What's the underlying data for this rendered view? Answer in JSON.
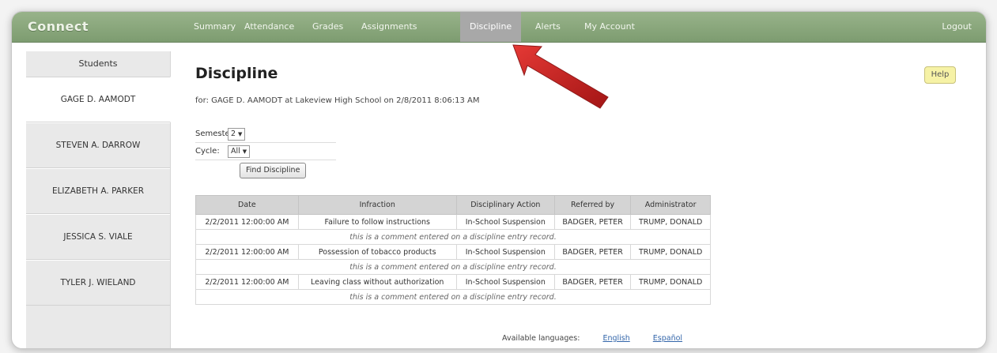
{
  "brand": "Connect",
  "nav": {
    "items": [
      "Summary",
      "Attendance",
      "Grades",
      "Assignments",
      "Discipline",
      "Alerts",
      "My Account"
    ],
    "active": "Discipline",
    "logout": "Logout"
  },
  "sidebar": {
    "title": "Students",
    "students": [
      "GAGE D. AAMODT",
      "STEVEN A. DARROW",
      "ELIZABETH A. PARKER",
      "JESSICA S. VIALE",
      "TYLER J. WIELAND"
    ],
    "selected": "GAGE D. AAMODT"
  },
  "page": {
    "title": "Discipline",
    "subtitle": "for: GAGE D. AAMODT at Lakeview High School on 2/8/2011 8:06:13 AM",
    "help": "Help"
  },
  "filters": {
    "semester_label": "Semester:",
    "semester_value": "2",
    "cycle_label": "Cycle:",
    "cycle_value": "All",
    "find_button": "Find Discipline"
  },
  "table": {
    "headers": [
      "Date",
      "Infraction",
      "Disciplinary Action",
      "Referred by",
      "Administrator"
    ],
    "rows": [
      {
        "date": "2/2/2011 12:00:00 AM",
        "infraction": "Failure to follow instructions",
        "action": "In-School Suspension",
        "referred_by": "BADGER, PETER",
        "administrator": "TRUMP, DONALD",
        "comment": "this is a comment entered on a discipline entry record."
      },
      {
        "date": "2/2/2011 12:00:00 AM",
        "infraction": "Possession of tobacco products",
        "action": "In-School Suspension",
        "referred_by": "BADGER, PETER",
        "administrator": "TRUMP, DONALD",
        "comment": "this is a comment entered on a discipline entry record."
      },
      {
        "date": "2/2/2011 12:00:00 AM",
        "infraction": "Leaving class without authorization",
        "action": "In-School Suspension",
        "referred_by": "BADGER, PETER",
        "administrator": "TRUMP, DONALD",
        "comment": "this is a comment entered on a discipline entry record."
      }
    ]
  },
  "languages": {
    "label": "Available languages:",
    "options": [
      "English",
      "Español"
    ]
  },
  "colors": {
    "nav_green": "#8aa87c",
    "active_tab": "#a8a8a8",
    "help_yellow": "#f6f2a6",
    "arrow_red": "#c62828"
  }
}
